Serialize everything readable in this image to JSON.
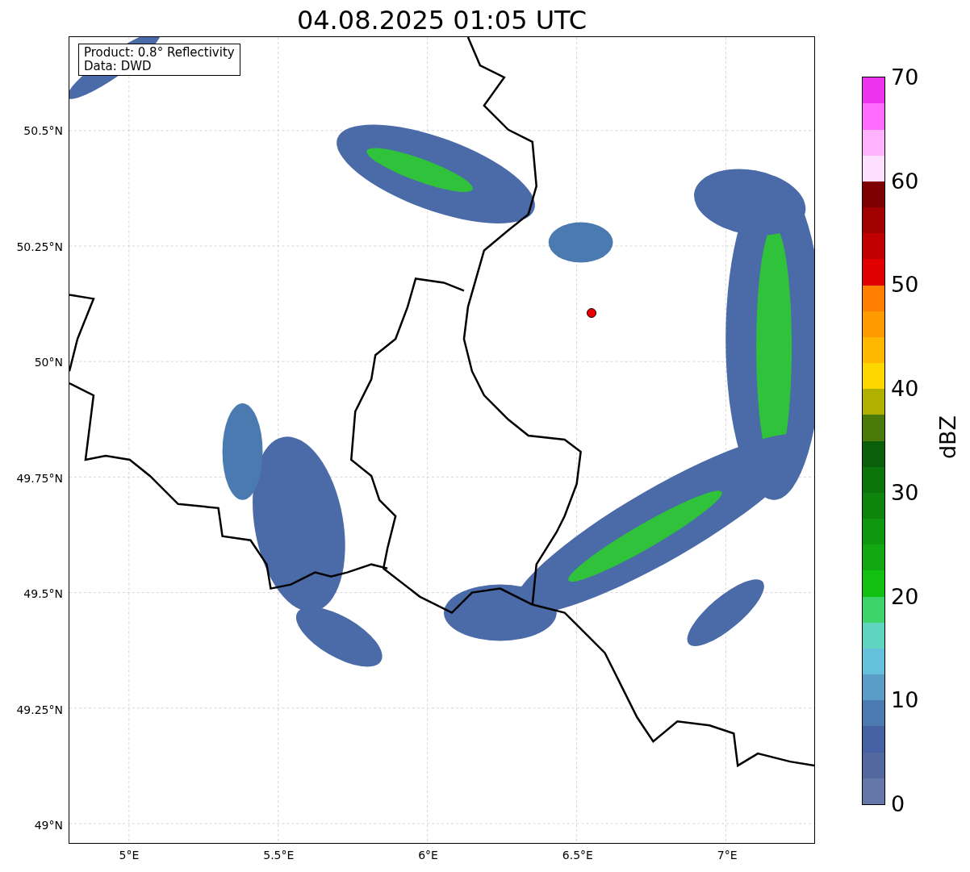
{
  "title": "04.08.2025 01:05 UTC",
  "info_box": [
    "Product: 0.8° Reflectivity",
    "Data: DWD"
  ],
  "map": {
    "y_ticks": [
      "50.5°N",
      "50.25°N",
      "50°N",
      "49.75°N",
      "49.5°N",
      "49.25°N",
      "49°N"
    ],
    "x_ticks": [
      "5°E",
      "5.5°E",
      "6°E",
      "6.5°E",
      "7°E"
    ]
  },
  "colorbar": {
    "label": "dBZ",
    "ticks": [
      "70",
      "60",
      "50",
      "40",
      "30",
      "20",
      "10",
      "0"
    ],
    "segments": [
      {
        "color": "#6577a8"
      },
      {
        "color": "#5468a0"
      },
      {
        "color": "#4560a3"
      },
      {
        "color": "#4a7ab0"
      },
      {
        "color": "#5a9ec8"
      },
      {
        "color": "#65c0dc"
      },
      {
        "color": "#5fd5c0"
      },
      {
        "color": "#3dd46b"
      },
      {
        "color": "#12c012"
      },
      {
        "color": "#11a811"
      },
      {
        "color": "#0f970f"
      },
      {
        "color": "#0d850d"
      },
      {
        "color": "#0b740b"
      },
      {
        "color": "#0a600a"
      },
      {
        "color": "#4a7a0a"
      },
      {
        "color": "#b0b000"
      },
      {
        "color": "#ffd700"
      },
      {
        "color": "#ffb700"
      },
      {
        "color": "#ff9a00"
      },
      {
        "color": "#ff7f00"
      },
      {
        "color": "#e00000"
      },
      {
        "color": "#c00000"
      },
      {
        "color": "#a00000"
      },
      {
        "color": "#7f0000"
      },
      {
        "color": "#ffdfff"
      },
      {
        "color": "#ffb3ff"
      },
      {
        "color": "#ff6bff"
      },
      {
        "color": "#ee33ee"
      }
    ]
  }
}
